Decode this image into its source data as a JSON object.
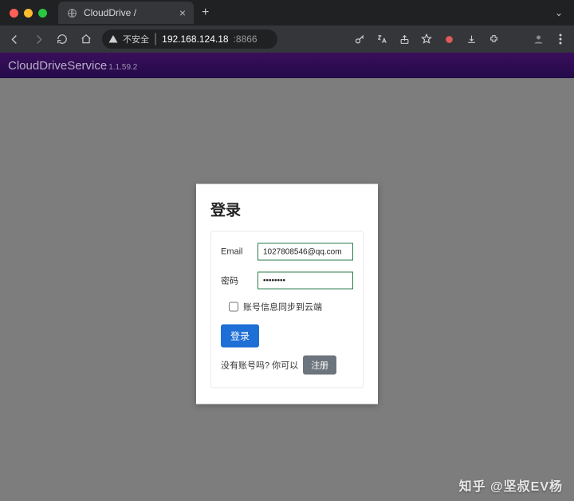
{
  "browser": {
    "tab_title": "CloudDrive /",
    "insecure_label": "不安全",
    "address_host": "192.168.124.18",
    "address_port": ":8866"
  },
  "header": {
    "brand": "CloudDriveService",
    "version": "1.1.59.2"
  },
  "login": {
    "title": "登录",
    "email_label": "Email",
    "email_value": "1027808546@qq.com",
    "password_label": "密码",
    "password_value": "••••••••",
    "sync_label": "账号信息同步到云端",
    "submit_label": "登录",
    "signup_prompt": "没有账号吗? 你可以",
    "signup_button": "注册"
  },
  "watermark": "知乎 @坚叔EV杨"
}
